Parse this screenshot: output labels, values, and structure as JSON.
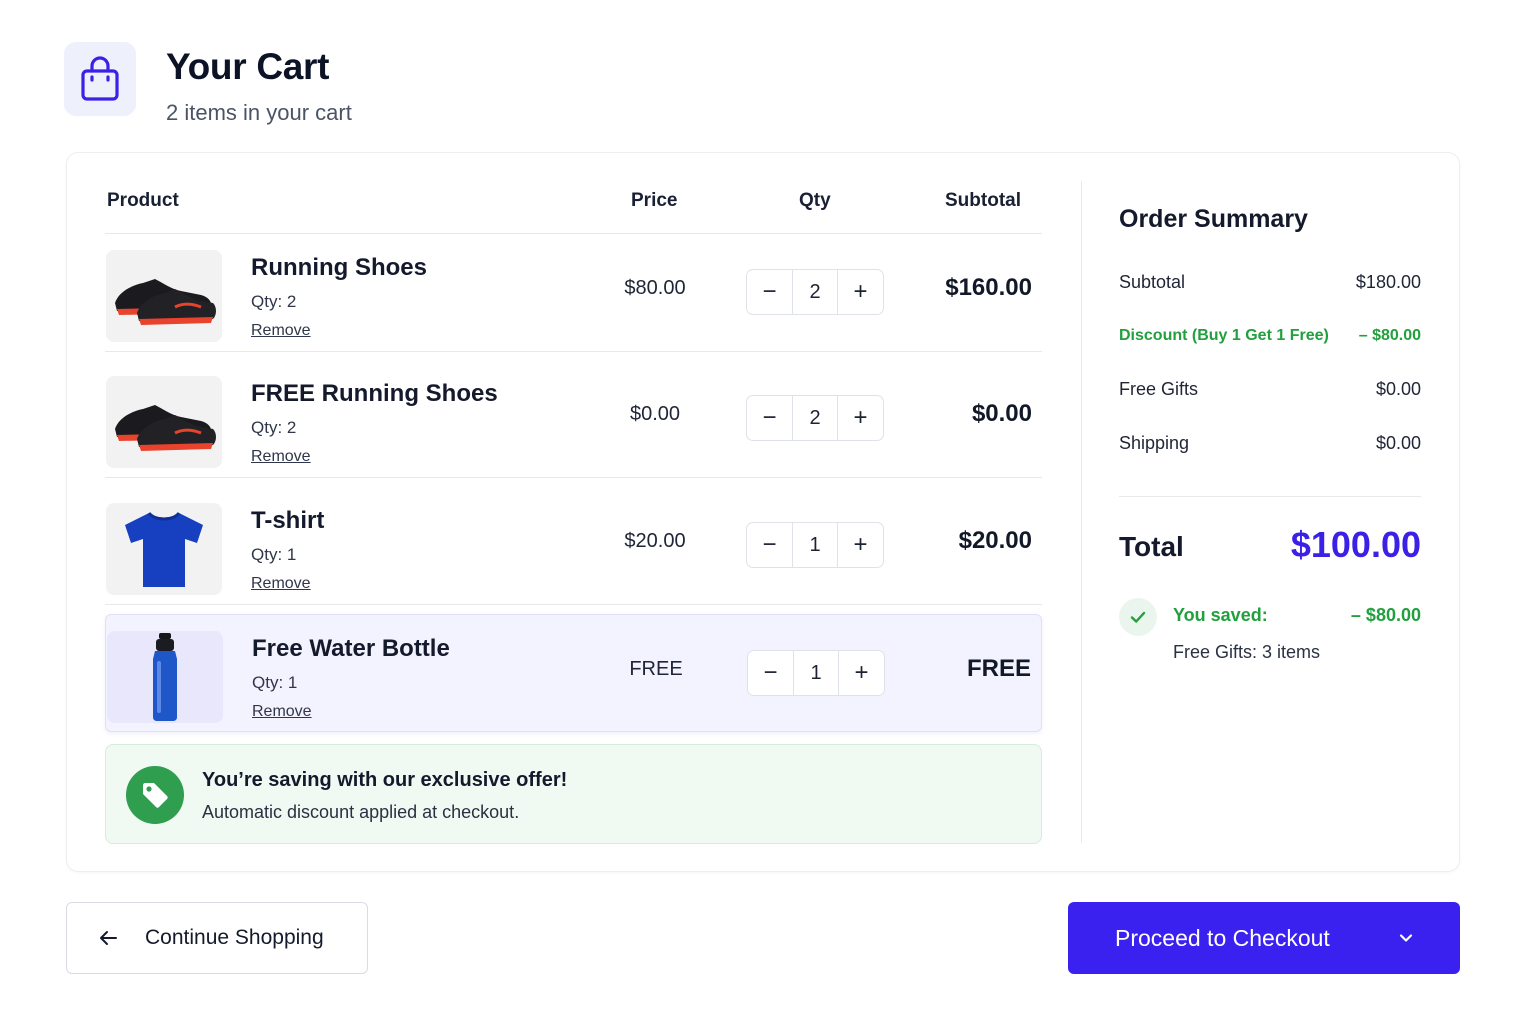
{
  "header": {
    "title": "Your Cart",
    "subtitle": "2 items in your cart",
    "icon": "shopping-bag-icon",
    "accent_color": "#3b21e6"
  },
  "table": {
    "headers": {
      "product": "Product",
      "price": "Price",
      "qty": "Qty",
      "subtotal": "Subtotal"
    },
    "items": [
      {
        "name": "Running Shoes",
        "qty_label": "Qty: 2",
        "remove": "Remove",
        "price": "$80.00",
        "qty": "2",
        "subtotal": "$160.00",
        "image": "running-shoes-image"
      },
      {
        "name": "FREE Running Shoes",
        "qty_label": "Qty: 2",
        "remove": "Remove",
        "price": "$0.00",
        "qty": "2",
        "subtotal": "$0.00",
        "image": "running-shoes-image"
      },
      {
        "name": "T-shirt",
        "qty_label": "Qty: 1",
        "remove": "Remove",
        "price": "$20.00",
        "qty": "1",
        "subtotal": "$20.00",
        "image": "tshirt-image"
      },
      {
        "name": "Free Water Bottle",
        "qty_label": "Qty: 1",
        "remove": "Remove",
        "price": "FREE",
        "qty": "1",
        "subtotal": "FREE",
        "image": "water-bottle-image",
        "highlighted": true
      }
    ],
    "stepper": {
      "minus": "−",
      "plus": "+"
    }
  },
  "promo": {
    "title": "You’re saving with our exclusive offer!",
    "subtitle": "Automatic discount applied at checkout.",
    "icon": "tag-icon",
    "color": "#2f9e4f"
  },
  "summary": {
    "title": "Order Summary",
    "rows": [
      {
        "label": "Subtotal",
        "value": "$180.00"
      },
      {
        "label": "Discount (Buy 1 Get 1 Free)",
        "value": "– $80.00",
        "highlight": true
      },
      {
        "label": "Free Gifts",
        "value": "$0.00"
      },
      {
        "label": "Shipping",
        "value": "$0.00"
      }
    ],
    "total_label": "Total",
    "total_value": "$100.00",
    "saved_label": "You saved:",
    "saved_value": "– $80.00",
    "free_gifts": "Free Gifts: 3 items",
    "saved_color": "#21a03d"
  },
  "actions": {
    "continue_label": "Continue Shopping",
    "checkout_label": "Proceed to Checkout",
    "checkout_color": "#3b21f0"
  }
}
